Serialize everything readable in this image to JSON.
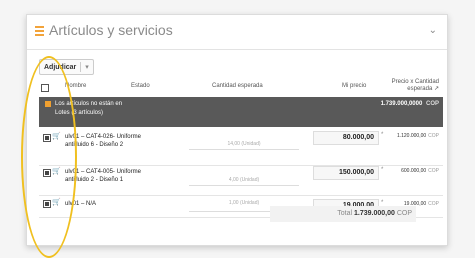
{
  "section": {
    "title": "Artículos y servicios"
  },
  "toolbar": {
    "adjust_label": "Adjudicar",
    "adjust_caret": "▾"
  },
  "columns": {
    "name": "Nombre",
    "status": "Estado",
    "expected_qty": "Cantidad esperada",
    "my_price": "Mi precio",
    "price_qty": "Precio x Cantidad esperada",
    "sort_arrow": "↗"
  },
  "group": {
    "line1": "Los artículos no están en",
    "line2": "Lotes (3 artículos)",
    "total": "1.739.000,0000",
    "currency": "COP"
  },
  "rows": [
    {
      "name": "ulv01 – CAT4-026- Uniforme antifluido 6 - Diseño 2",
      "qty": "14,00 (Unidad)",
      "price": "80.000,00",
      "total": "1.120.000,00",
      "currency": "COP"
    },
    {
      "name": "ulv01 – CAT4-005- Uniforme antifluido 2 - Diseño 1",
      "qty": "4,00 (Unidad)",
      "price": "150.000,00",
      "total": "600.000,00",
      "currency": "COP"
    },
    {
      "name": "ulv01 – N/A",
      "qty": "1,00 (Unidad)",
      "price": "19.000,00",
      "total": "19.000,00",
      "currency": "COP"
    }
  ],
  "footer": {
    "total_label": "Total",
    "total_value": "1.739.000,00",
    "currency": "COP"
  },
  "colors": {
    "accent": "#f2a33a",
    "group_bg": "#595959",
    "annotation": "#f0c020"
  }
}
